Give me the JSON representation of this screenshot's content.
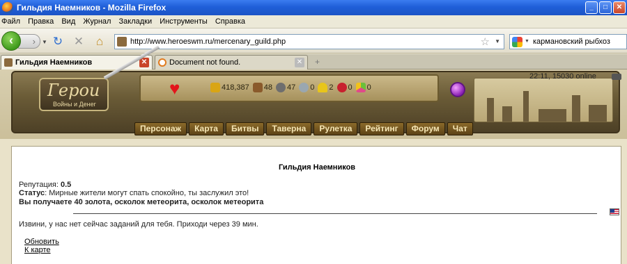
{
  "window": {
    "title": "Гильдия Наемников - Mozilla Firefox"
  },
  "menu": [
    "Файл",
    "Правка",
    "Вид",
    "Журнал",
    "Закладки",
    "Инструменты",
    "Справка"
  ],
  "navbar": {
    "url": "http://www.heroeswm.ru/mercenary_guild.php",
    "search_query": "кармановский рыбхоз"
  },
  "tabs": [
    {
      "label": "Гильдия Наемников",
      "active": true
    },
    {
      "label": "Document not found.",
      "active": false
    }
  ],
  "header": {
    "logo_title": "Герои",
    "logo_subtitle": "Войны и Денег",
    "clock": "22:11, 15030 online",
    "resources": [
      {
        "icon": "gold-icon",
        "value": "418,387",
        "color": "#d9a514"
      },
      {
        "icon": "wood-icon",
        "value": "48",
        "color": "#8a5a2b"
      },
      {
        "icon": "ore-icon",
        "value": "47",
        "color": "#6e6e6e"
      },
      {
        "icon": "mercury-icon",
        "value": "0",
        "color": "#9aa7b0"
      },
      {
        "icon": "sulfur-icon",
        "value": "2",
        "color": "#e8c51a"
      },
      {
        "icon": "crystal-icon",
        "value": "0",
        "color": "#c8202e"
      },
      {
        "icon": "gems-icon",
        "value": "0",
        "color": "#6bbf3a"
      }
    ],
    "nav": [
      "Персонаж",
      "Карта",
      "Битвы",
      "Таверна",
      "Рулетка",
      "Рейтинг",
      "Форум",
      "Чат"
    ]
  },
  "guild": {
    "title": "Гильдия Наемников",
    "reputation_label": "Репутация: ",
    "reputation_value": "0.5",
    "status_label": "Статус",
    "status_text": ": Мирные жители могут спать спокойно, ты заслужил это!",
    "reward": "Вы получаете 40 золота, осколок метеорита, осколок метеорита",
    "no_tasks": "Извини, у нас нет сейчас заданий для тебя. Приходи через 39 мин.",
    "links": {
      "refresh": "Обновить",
      "to_map": "К карте"
    }
  }
}
